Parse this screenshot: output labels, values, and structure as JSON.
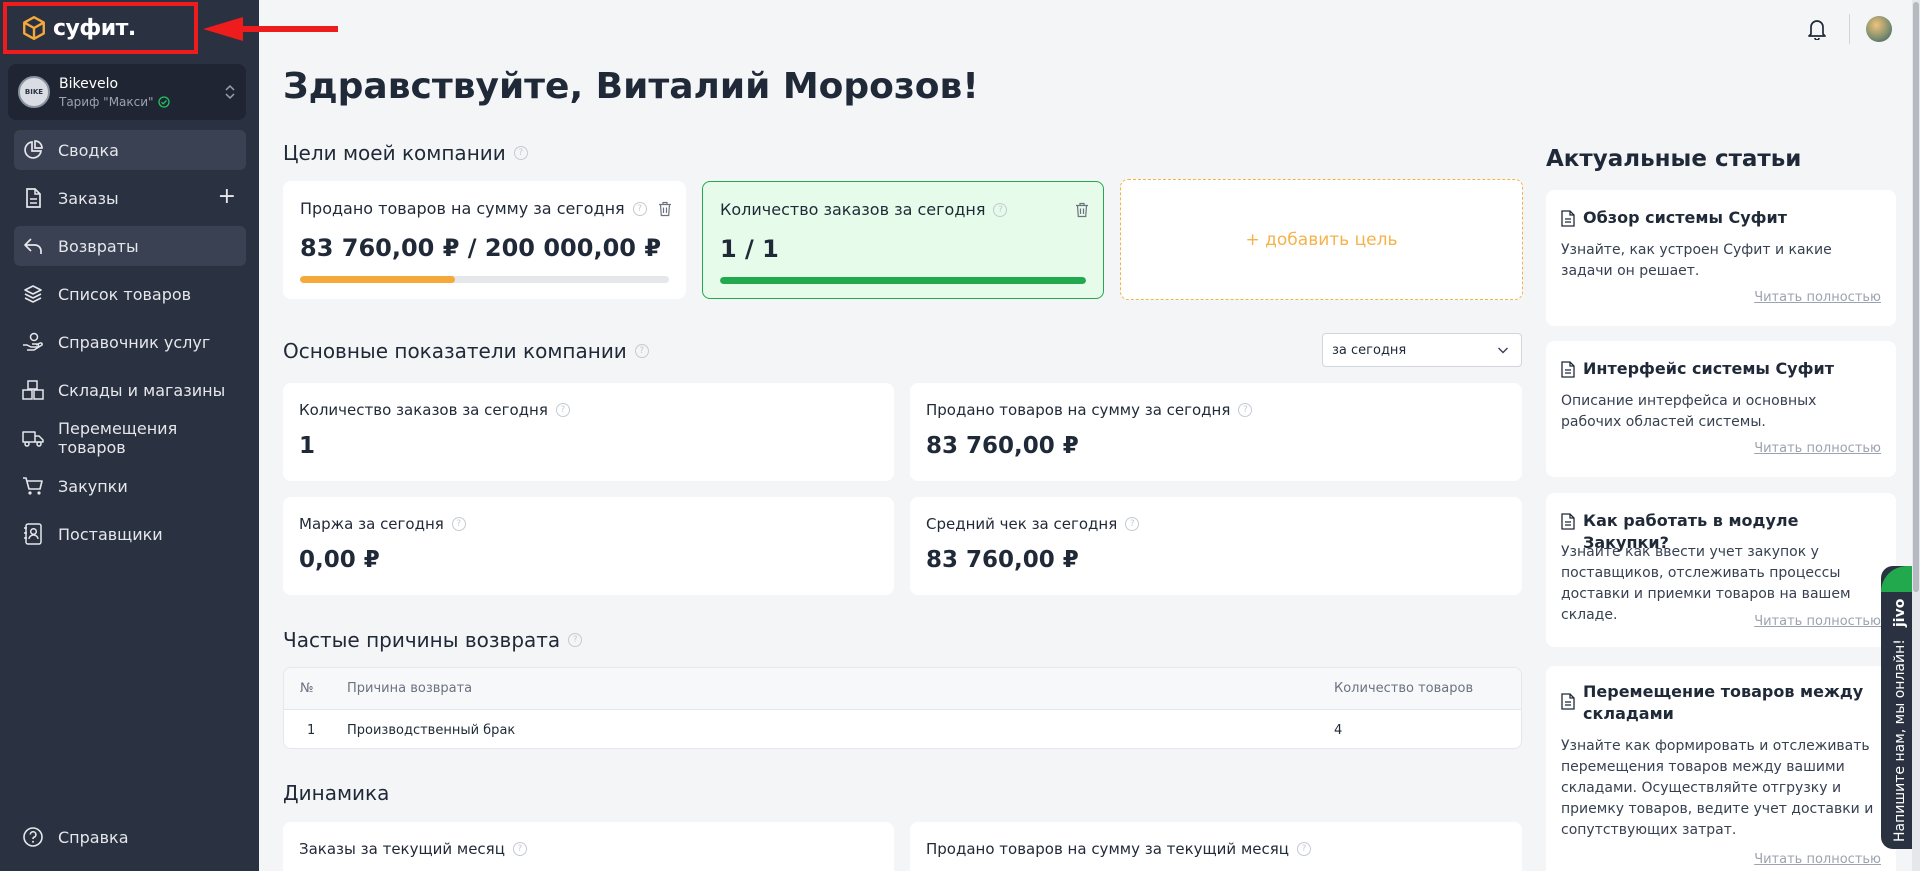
{
  "brand": {
    "logo_text": "суфит."
  },
  "company": {
    "name": "Bikevelo",
    "plan": "Тариф \"Макси\"",
    "avatar_text": "BIKE"
  },
  "nav": [
    {
      "label": "Сводка",
      "icon": "pie-chart-icon",
      "active": true
    },
    {
      "label": "Заказы",
      "icon": "document-icon",
      "active": false
    },
    {
      "label": "Возвраты",
      "icon": "return-arrow-icon",
      "active": true
    },
    {
      "label": "Список товаров",
      "icon": "layers-icon",
      "active": false
    },
    {
      "label": "Справочник услуг",
      "icon": "hand-coin-icon",
      "active": false
    },
    {
      "label": "Склады и магазины",
      "icon": "boxes-icon",
      "active": false
    },
    {
      "label": "Перемещения товаров",
      "icon": "truck-icon",
      "active": false
    },
    {
      "label": "Закупки",
      "icon": "cart-icon",
      "active": false
    },
    {
      "label": "Поставщики",
      "icon": "contacts-icon",
      "active": false
    }
  ],
  "nav_add_symbol": "+",
  "help_label": "Справка",
  "greeting": "Здравствуйте, Виталий Морозов!",
  "goals": {
    "title": "Цели моей компании",
    "items": [
      {
        "label": "Продано товаров на сумму за сегодня",
        "value": "83 760,00 ₽ / 200 000,00 ₽",
        "progress": 0.42,
        "color": "#f5a93b"
      },
      {
        "label": "Количество заказов за сегодня",
        "value": "1 / 1",
        "progress": 1.0,
        "color": "#22a94d"
      }
    ],
    "add_label": "+ добавить цель"
  },
  "metrics": {
    "title": "Основные показатели компании",
    "period": "за сегодня",
    "items": [
      {
        "label": "Количество заказов за сегодня",
        "value": "1"
      },
      {
        "label": "Продано товаров на сумму за сегодня",
        "value": "83 760,00 ₽"
      },
      {
        "label": "Маржа за сегодня",
        "value": "0,00 ₽"
      },
      {
        "label": "Средний чек за сегодня",
        "value": "83 760,00 ₽"
      }
    ]
  },
  "returns": {
    "title": "Частые причины возврата",
    "columns": [
      "№",
      "Причина возврата",
      "Количество товаров"
    ],
    "rows": [
      [
        "1",
        "Производственный брак",
        "4"
      ]
    ]
  },
  "dynamics": {
    "title": "Динамика",
    "items": [
      {
        "label": "Заказы за текущий месяц"
      },
      {
        "label": "Продано товаров на сумму за текущий месяц"
      }
    ]
  },
  "articles": {
    "title": "Актуальные статьи",
    "link_label": "Читать полностью",
    "items": [
      {
        "title": "Обзор системы Суфит",
        "desc": "Узнайте, как устроен Суфит и какие задачи он решает."
      },
      {
        "title": "Интерфейс системы Суфит",
        "desc": "Описание интерфейса и основных рабочих областей системы."
      },
      {
        "title": "Как работать в модуле Закупки?",
        "desc": "Узнайте как ввести учет закупок у поставщиков, отслеживать процессы доставки и приемки товаров на вашем складе."
      },
      {
        "title": "Перемещение товаров между складами",
        "desc": "Узнайте как формировать и отслеживать перемещения товаров между вашими складами. Осуществляйте отгрузку и приемку товаров, ведите учет доставки и сопутствующих затрат."
      }
    ]
  },
  "chat_widget": {
    "text": "Напишите нам, мы онлайн!",
    "brand": "jivo"
  },
  "colors": {
    "sidebar": "#2a3140",
    "accent_orange": "#f5a93b",
    "accent_green": "#22a94d",
    "highlight_red": "#ee1c1c"
  }
}
